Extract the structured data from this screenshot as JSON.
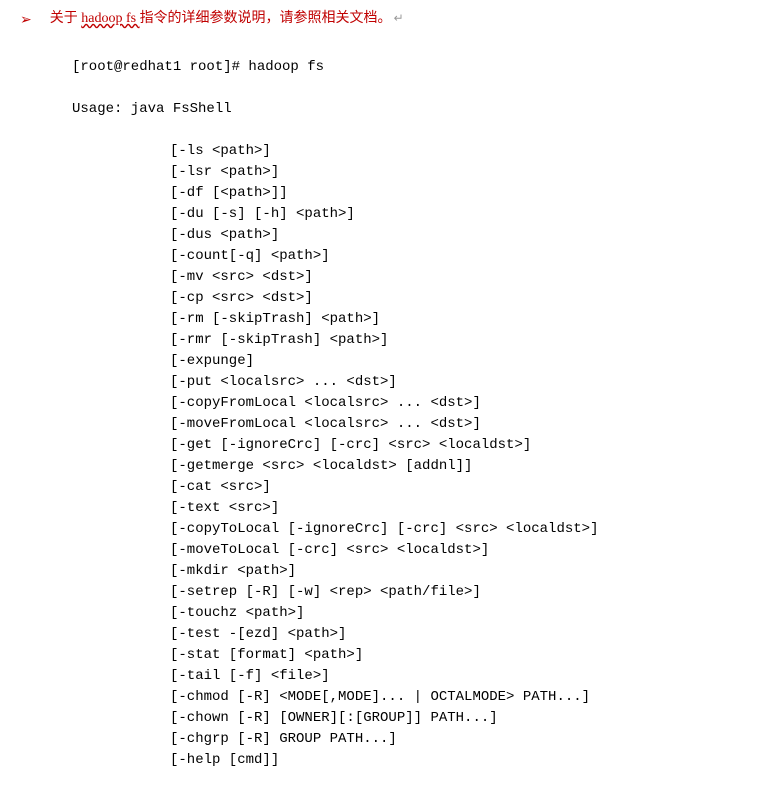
{
  "note": {
    "bullet": "➢",
    "prefix": "关于 ",
    "cmd": "hadoop fs ",
    "suffix": "指令的详细参数说明，请参照相关文档。",
    "ret": "↵"
  },
  "terminal": {
    "prompt": "[root@redhat1 root]# hadoop fs",
    "usage": "Usage: java FsShell",
    "options": [
      "[-ls <path>]",
      "[-lsr <path>]",
      "[-df [<path>]]",
      "[-du [-s] [-h] <path>]",
      "[-dus <path>]",
      "[-count[-q] <path>]",
      "[-mv <src> <dst>]",
      "[-cp <src> <dst>]",
      "[-rm [-skipTrash] <path>]",
      "[-rmr [-skipTrash] <path>]",
      "[-expunge]",
      "[-put <localsrc> ... <dst>]",
      "[-copyFromLocal <localsrc> ... <dst>]",
      "[-moveFromLocal <localsrc> ... <dst>]",
      "[-get [-ignoreCrc] [-crc] <src> <localdst>]",
      "[-getmerge <src> <localdst> [addnl]]",
      "[-cat <src>]",
      "[-text <src>]",
      "[-copyToLocal [-ignoreCrc] [-crc] <src> <localdst>]",
      "[-moveToLocal [-crc] <src> <localdst>]",
      "[-mkdir <path>]",
      "[-setrep [-R] [-w] <rep> <path/file>]",
      "[-touchz <path>]",
      "[-test -[ezd] <path>]",
      "[-stat [format] <path>]",
      "[-tail [-f] <file>]",
      "[-chmod [-R] <MODE[,MODE]... | OCTALMODE> PATH...]",
      "[-chown [-R] [OWNER][:[GROUP]] PATH...]",
      "[-chgrp [-R] GROUP PATH...]",
      "[-help [cmd]]"
    ]
  }
}
